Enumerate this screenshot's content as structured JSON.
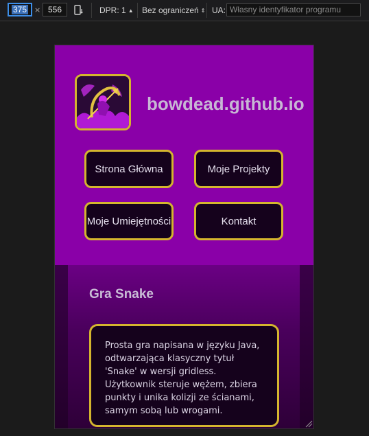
{
  "devtools": {
    "width_value": "375",
    "times_sign": "×",
    "height_value": "556",
    "dpr_label": "DPR: 1",
    "throttle_label": "Bez ograniczeń",
    "ua_label": "UA:",
    "ua_placeholder": "Własny identyfikator programu"
  },
  "site": {
    "title": "bowdead.github.io",
    "nav": [
      "Strona Główna",
      "Moje Projekty",
      "Moje Umiejętności",
      "Kontakt"
    ]
  },
  "project": {
    "title": "Gra Snake",
    "description": "Prosta gra napisana w języku Java, odtwarzająca klasyczny tytuł 'Snake' w wersji gridless. Użytkownik steruje wężem, zbiera punkty i unika kolizji ze ścianami, samym sobą lub wrogami."
  },
  "colors": {
    "header_bg": "#8a00a8",
    "accent_border": "#d4b52e",
    "button_bg": "#15021c",
    "focus_blue": "#3d8ee8"
  }
}
